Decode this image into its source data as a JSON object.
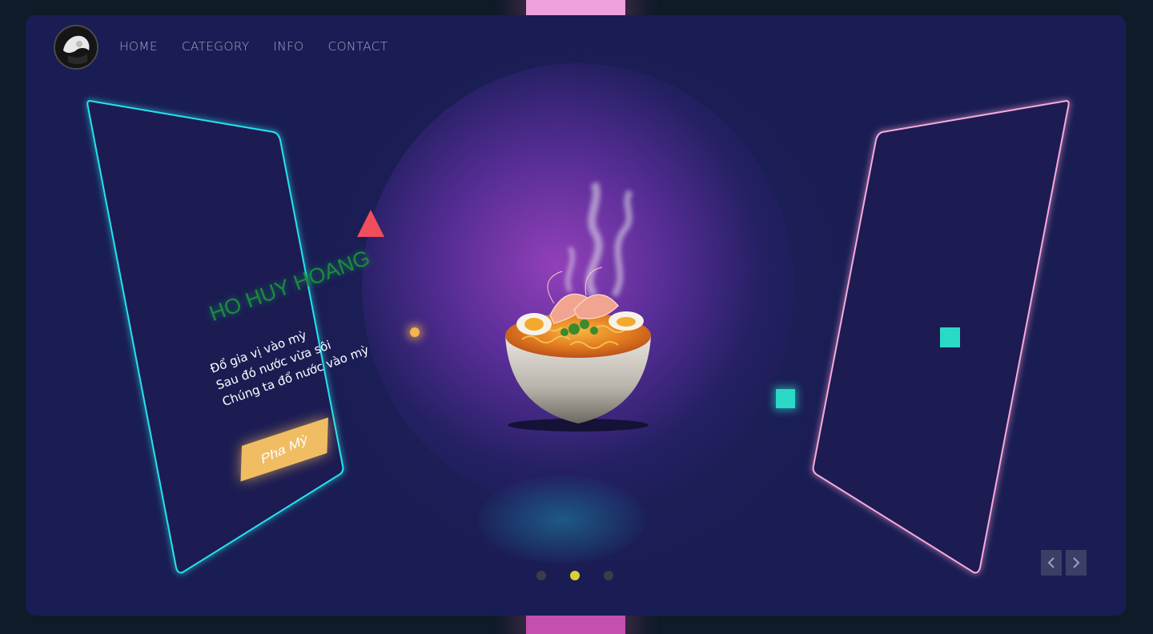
{
  "nav": {
    "items": [
      {
        "label": "HOME"
      },
      {
        "label": "CATEGORY"
      },
      {
        "label": "INFO"
      },
      {
        "label": "CONTACT"
      }
    ]
  },
  "hero": {
    "name": "HO HUY HOANG",
    "lines": [
      "Đổ gia vị vào mỳ",
      "Sau đó nước vừa sôi",
      "Chúng ta đổ nước vào mỳ"
    ],
    "cta_label": "Pha Mỳ"
  },
  "slider": {
    "total": 3,
    "active_index": 1
  },
  "icons": {
    "logo": "avatar-logo",
    "prev": "chevron-left-icon",
    "next": "chevron-right-icon"
  },
  "colors": {
    "background": "#0f1b29",
    "stage": "#1a1d53",
    "left_panel_glow": "#28e0f0",
    "right_panel_glow": "#f7a8dc",
    "brand_text": "#1c8a3e",
    "cta": "#f0bd63",
    "active_dot": "#d9d133",
    "accent_teal": "#2ad9c6",
    "accent_red": "#f04e5c"
  }
}
